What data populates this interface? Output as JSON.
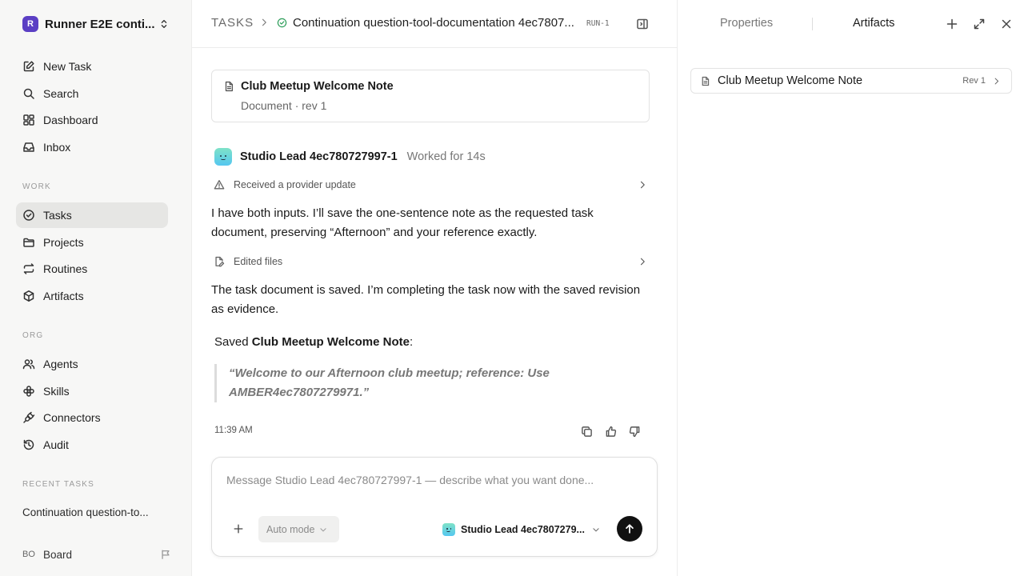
{
  "sidebar": {
    "workspace": {
      "logo": "R",
      "name": "Runner E2E conti..."
    },
    "top_items": [
      {
        "label": "New Task",
        "icon": "pencil-square-icon"
      },
      {
        "label": "Search",
        "icon": "search-icon"
      },
      {
        "label": "Dashboard",
        "icon": "dashboard-grid-icon"
      },
      {
        "label": "Inbox",
        "icon": "inbox-icon"
      }
    ],
    "work_label": "WORK",
    "work_items": [
      {
        "label": "Tasks",
        "icon": "check-circle-icon",
        "active": true
      },
      {
        "label": "Projects",
        "icon": "folder-icon"
      },
      {
        "label": "Routines",
        "icon": "repeat-icon"
      },
      {
        "label": "Artifacts",
        "icon": "cube-icon"
      }
    ],
    "org_label": "ORG",
    "org_items": [
      {
        "label": "Agents",
        "icon": "users-icon"
      },
      {
        "label": "Skills",
        "icon": "flower-icon"
      },
      {
        "label": "Connectors",
        "icon": "plug-icon"
      },
      {
        "label": "Audit",
        "icon": "history-icon"
      }
    ],
    "recent_label": "RECENT TASKS",
    "recent_task": "Continuation question-to...",
    "board": {
      "initials": "BO",
      "label": "Board"
    }
  },
  "header": {
    "root": "TASKS",
    "title": "Continuation question-tool-documentation 4ec7807...",
    "run_badge": "RUN-1"
  },
  "doc_card": {
    "title": "Club Meetup Welcome Note",
    "meta": "Document · rev 1"
  },
  "agent": {
    "name": "Studio Lead 4ec780727997-1",
    "worked": "Worked for 14s"
  },
  "steps": {
    "provider_update": "Received a provider update",
    "edited_files": "Edited files"
  },
  "messages": {
    "first": "I have both inputs. I’ll save the one-sentence note as the requested task document, preserving “Afternoon” and your reference exactly.",
    "second": "The task document is saved. I’m completing the task now with the saved revision as evidence.",
    "saved_prefix": "Saved",
    "saved_name": "Club Meetup Welcome Note",
    "saved_suffix": ":",
    "quote": "“Welcome to our Afternoon club meetup; reference: Use AMBER4ec7807279971.”",
    "time": "11:39 AM"
  },
  "composer": {
    "placeholder": "Message Studio Lead 4ec780727997-1 — describe what you want done...",
    "mode": "Auto mode",
    "agent": "Studio Lead 4ec7807279..."
  },
  "right_panel": {
    "tab_properties": "Properties",
    "tab_artifacts": "Artifacts",
    "artifact": {
      "title": "Club Meetup Welcome Note",
      "rev": "Rev 1"
    }
  }
}
